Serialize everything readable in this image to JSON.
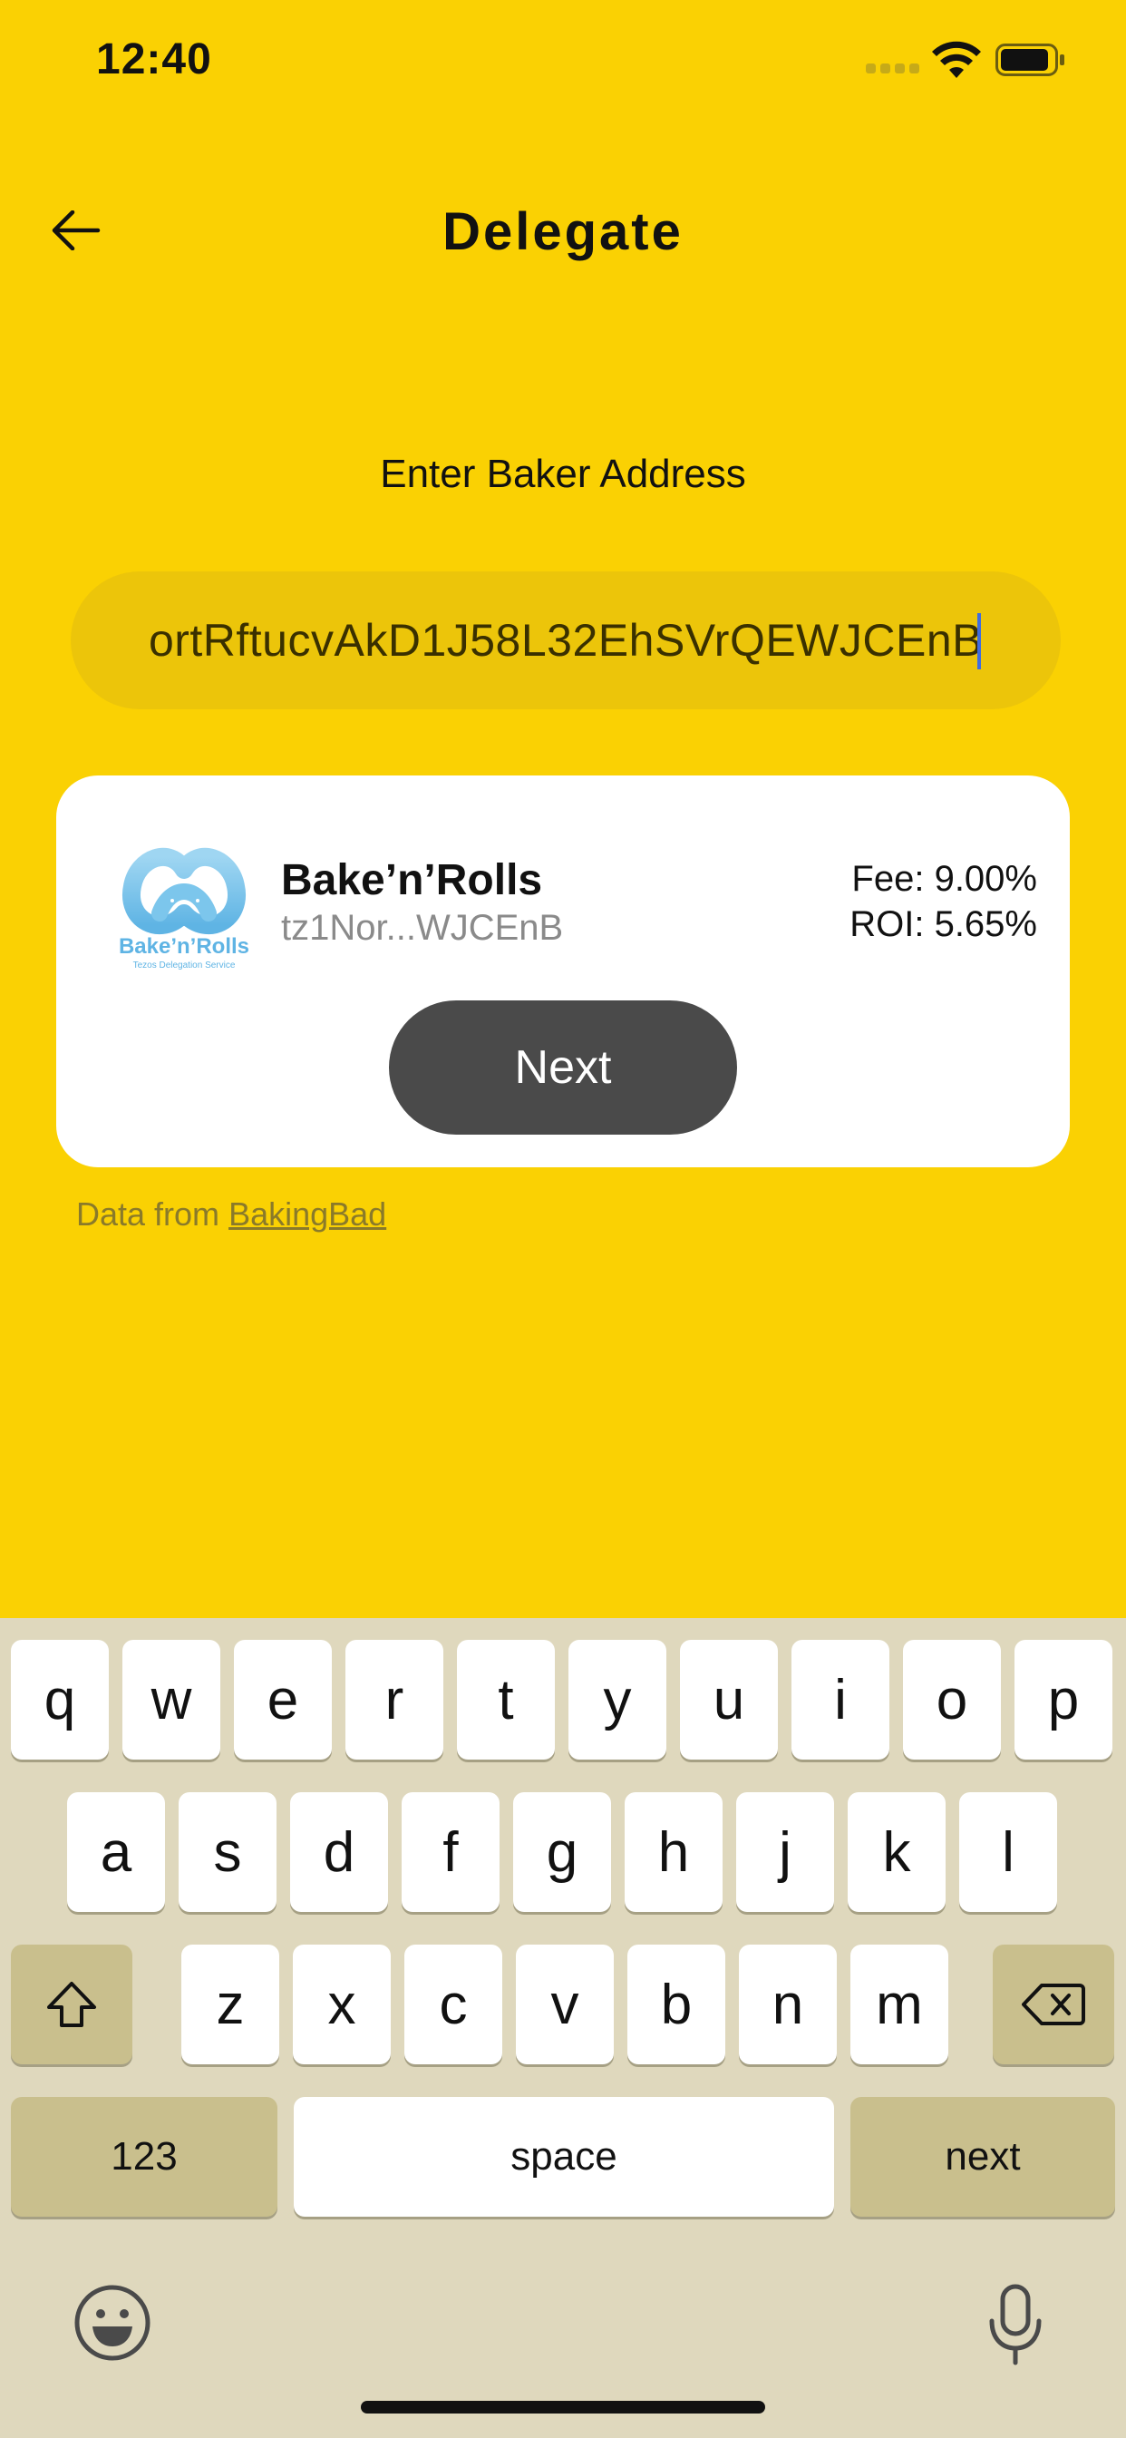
{
  "status_bar": {
    "time": "12:40"
  },
  "header": {
    "title": "Delegate"
  },
  "form": {
    "label": "Enter Baker Address",
    "address_value": "ortRftucvAkD1J58L32EhSVrQEWJCEnB"
  },
  "baker": {
    "name": "Bake’n’Rolls",
    "address_short": "tz1Nor...WJCEnB",
    "fee": "Fee: 9.00%",
    "roi": "ROI: 5.65%",
    "logo_text": "Bake’n’Rolls",
    "logo_subtext": "Tezos Delegation Service"
  },
  "actions": {
    "next_label": "Next"
  },
  "source": {
    "prefix": "Data from",
    "link": "BakingBad"
  },
  "keyboard": {
    "row1": [
      "q",
      "w",
      "e",
      "r",
      "t",
      "y",
      "u",
      "i",
      "o",
      "p"
    ],
    "row2": [
      "a",
      "s",
      "d",
      "f",
      "g",
      "h",
      "j",
      "k",
      "l"
    ],
    "row3": [
      "z",
      "x",
      "c",
      "v",
      "b",
      "n",
      "m"
    ],
    "numbers_label": "123",
    "space_label": "space",
    "return_label": "next"
  },
  "colors": {
    "background": "#fad103",
    "input_bg": "#ecc50a",
    "button_dark": "#4a4a4a",
    "keyboard_bg": "#dfd8bd"
  }
}
